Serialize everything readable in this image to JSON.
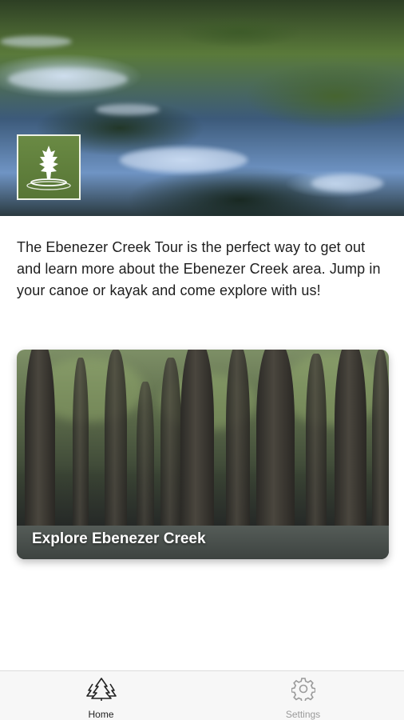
{
  "hero": {
    "logo_icon": "tree-logo-icon"
  },
  "intro": {
    "text": "The Ebenezer Creek Tour is the perfect way to get out and learn more about the Ebenezer Creek area. Jump in your canoe or kayak and come explore with us!"
  },
  "card": {
    "title": "Explore Ebenezer Creek"
  },
  "tabbar": {
    "tabs": [
      {
        "label": "Home",
        "icon": "trees-icon",
        "active": true
      },
      {
        "label": "Settings",
        "icon": "gear-icon",
        "active": false
      }
    ],
    "active_color": "#222222",
    "inactive_color": "#9a9a9a"
  }
}
